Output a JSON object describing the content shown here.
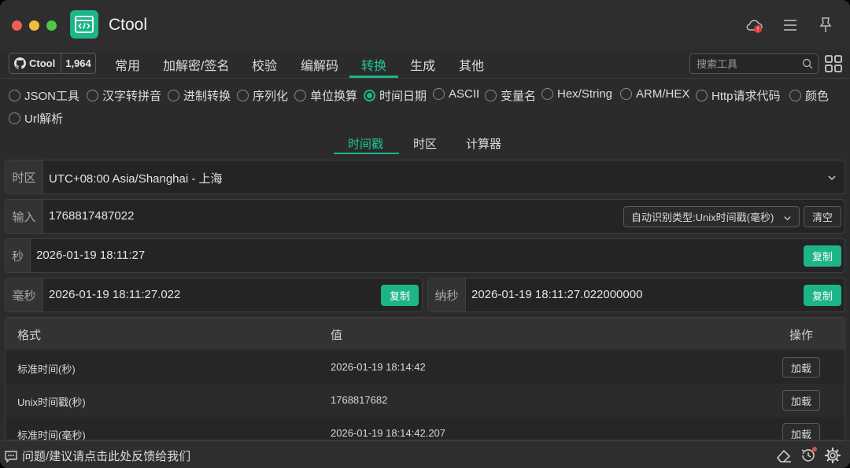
{
  "app": {
    "title": "Ctool",
    "accent": "#1db588"
  },
  "github": {
    "label": "Ctool",
    "count": "1,964"
  },
  "nav": {
    "items": [
      "常用",
      "加解密/签名",
      "校验",
      "编解码",
      "转换",
      "生成",
      "其他"
    ],
    "active": "转换",
    "search_placeholder": "搜索工具"
  },
  "tools": {
    "items": [
      "JSON工具",
      "汉字转拼音",
      "进制转换",
      "序列化",
      "单位换算",
      "时间日期",
      "ASCII",
      "变量名",
      "Hex/String",
      "ARM/HEX",
      "Http请求代码",
      "颜色",
      "Url解析"
    ],
    "selected": "时间日期"
  },
  "subtabs": {
    "items": [
      "时间戳",
      "时区",
      "计算器"
    ],
    "active": "时间戳"
  },
  "timezone": {
    "label": "时区",
    "value": "UTC+08:00 Asia/Shanghai - 上海"
  },
  "input": {
    "label": "输入",
    "value": "1768817487022",
    "type_select": "自动识别类型:Unix时间戳(毫秒)",
    "clear_label": "清空"
  },
  "seconds": {
    "label": "秒",
    "value": "2026-01-19 18:11:27",
    "copy_label": "复制"
  },
  "millis": {
    "label": "毫秒",
    "value": "2026-01-19 18:11:27.022",
    "copy_label": "复制"
  },
  "nanos": {
    "label": "纳秒",
    "value": "2026-01-19 18:11:27.022000000",
    "copy_label": "复制"
  },
  "table": {
    "headers": [
      "格式",
      "值",
      "操作"
    ],
    "rows": [
      {
        "format": "标准时间(秒)",
        "value": "2026-01-19 18:14:42",
        "action": "加载"
      },
      {
        "format": "Unix时间戳(秒)",
        "value": "1768817682",
        "action": "加载"
      },
      {
        "format": "标准时间(毫秒)",
        "value": "2026-01-19 18:14:42.207",
        "action": "加载"
      }
    ]
  },
  "footer": {
    "feedback": "问题/建议请点击此处反馈给我们"
  }
}
